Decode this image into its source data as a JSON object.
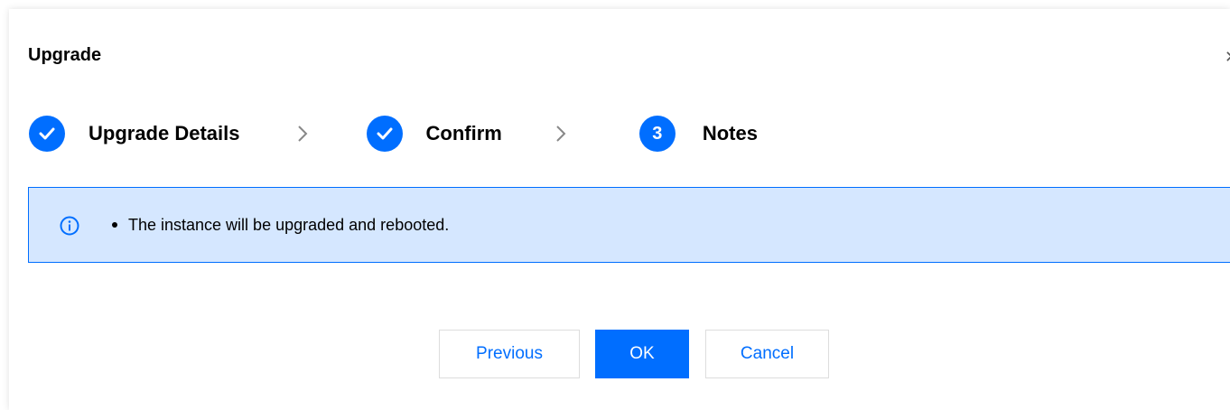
{
  "dialog": {
    "title": "Upgrade"
  },
  "steps": [
    {
      "label": "Upgrade Details",
      "status": "completed",
      "icon": "check-icon"
    },
    {
      "label": "Confirm",
      "status": "completed",
      "icon": "check-icon"
    },
    {
      "label": "Notes",
      "status": "current",
      "number": "3"
    }
  ],
  "alert": {
    "icon": "info-icon",
    "message": "The instance will be upgraded and rebooted."
  },
  "buttons": {
    "previous": "Previous",
    "ok": "OK",
    "cancel": "Cancel"
  },
  "colors": {
    "accent": "#006eff",
    "alert_background": "#d5e7ff",
    "secondary_border": "#dddddd"
  }
}
